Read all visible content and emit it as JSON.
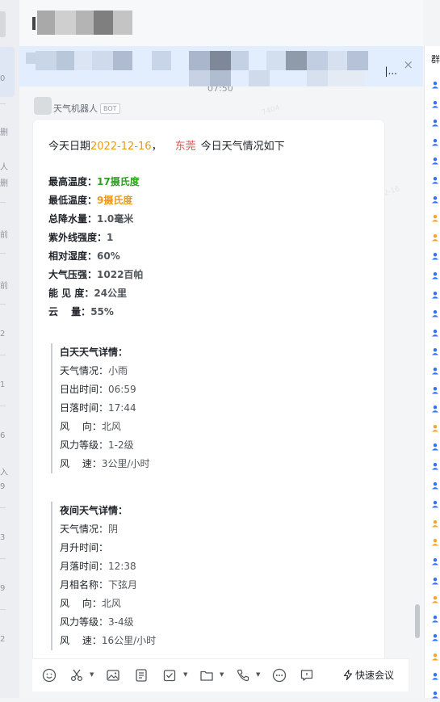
{
  "chat": {
    "time": "07:50",
    "sender": "天气机器人",
    "badge": "BOT"
  },
  "banner": {
    "more": "|...",
    "close_glyph": "×"
  },
  "message": {
    "intro_prefix": "今天日期",
    "date": "2022-12-16",
    "comma": "，",
    "city": "东莞",
    "intro_suffix": "今日天气情况如下",
    "stats": [
      {
        "label": "最高温度：",
        "value": "17摄氏度",
        "color": "#2ea121"
      },
      {
        "label": "最低温度：",
        "value": "9摄氏度",
        "color": "#e99a1c"
      },
      {
        "label": "总降水量：",
        "value": "1.0毫米"
      },
      {
        "label": "紫外线强度：",
        "value": "1"
      },
      {
        "label": "相对湿度：",
        "value": "60%"
      },
      {
        "label": "大气压强：",
        "value": "1022百帕"
      },
      {
        "label": "能 见 度：",
        "value": "24公里"
      },
      {
        "label": "云　 量：",
        "value": "55%"
      }
    ],
    "day": {
      "title": "白天天气详情：",
      "rows": [
        {
          "label": "天气情况：",
          "value": "小雨"
        },
        {
          "label": "日出时间：",
          "value": "06:59"
        },
        {
          "label": "日落时间：",
          "value": "17:44"
        },
        {
          "label": "风　 向：",
          "value": "北风"
        },
        {
          "label": "风力等级：",
          "value": "1-2级"
        },
        {
          "label": "风　 速：",
          "value": "3公里/小时"
        }
      ]
    },
    "night": {
      "title": "夜间天气详情：",
      "rows": [
        {
          "label": "天气情况：",
          "value": "阴"
        },
        {
          "label": "月升时间：",
          "value": ""
        },
        {
          "label": "月落时间：",
          "value": "12:38"
        },
        {
          "label": "月相名称：",
          "value": "下弦月"
        },
        {
          "label": "风　 向：",
          "value": "北风"
        },
        {
          "label": "风力等级：",
          "value": "3-4级"
        },
        {
          "label": "风　 速：",
          "value": "16公里/小时"
        }
      ]
    }
  },
  "toolbar": {
    "quick_meeting": "快速会议"
  },
  "right_panel": {
    "title": "群"
  },
  "left_rail": {
    "items": [
      "0",
      "删",
      "人",
      "删",
      "前",
      "前",
      "2",
      "1",
      "6",
      "入",
      "9",
      "3",
      "9",
      "2"
    ]
  },
  "watermarks": [
    "2022-12-16",
    "7404",
    "2022-12-16"
  ],
  "colors": {
    "date": "#e99a1c",
    "city": "#e0524b",
    "max_temp": "#2ea121",
    "min_temp": "#e99a1c",
    "banner_bg": "#e2edfd",
    "member_blue": "#3370ff",
    "member_orange": "#f5a623"
  },
  "icons": [
    "emoji-icon",
    "scissors-icon",
    "image-icon",
    "document-icon",
    "task-icon",
    "folder-icon",
    "phone-icon",
    "more-icon",
    "chat-bubble-icon",
    "lightning-icon",
    "close-icon",
    "member-icon"
  ]
}
